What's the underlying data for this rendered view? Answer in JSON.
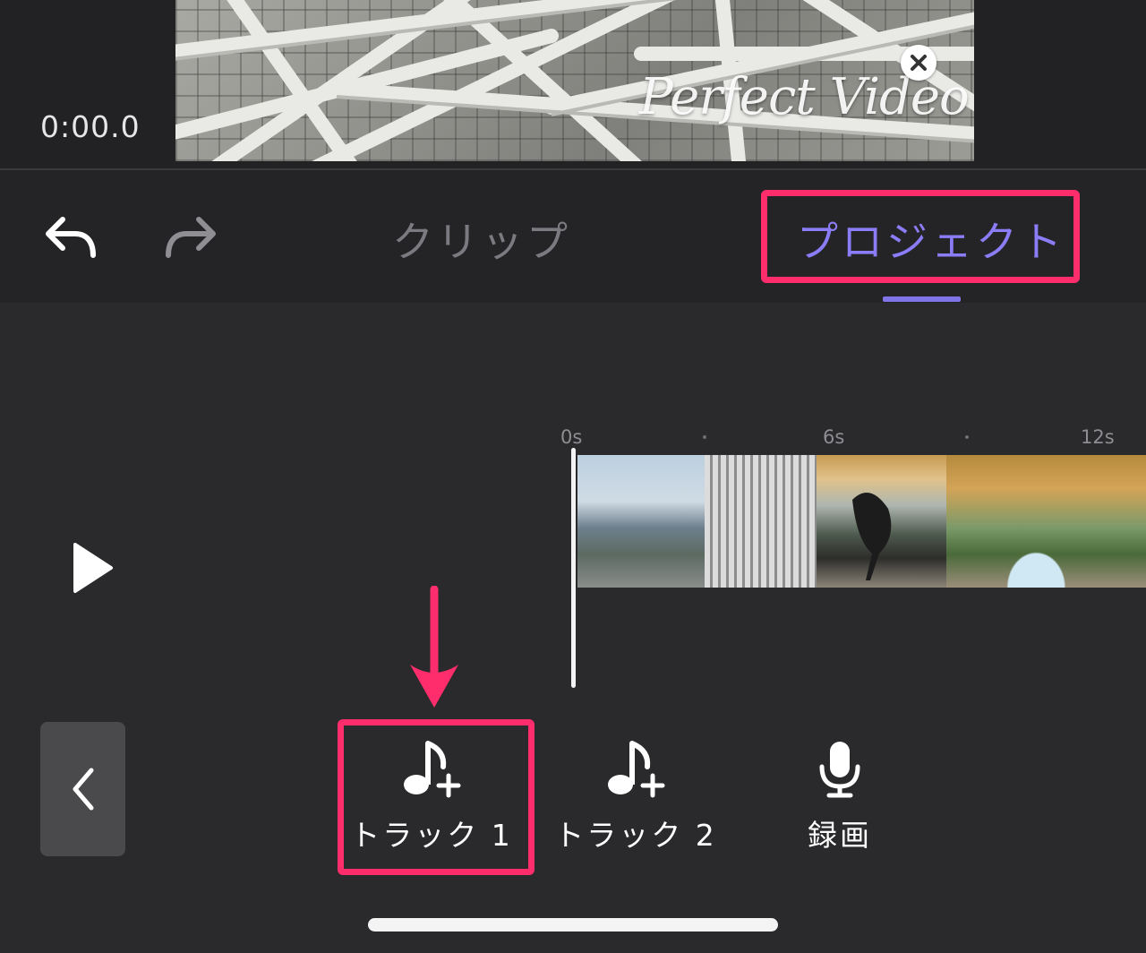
{
  "preview": {
    "timecode": "0:00.0",
    "watermark": "Perfect Video"
  },
  "toolbar": {
    "undo_icon": "undo-arrow",
    "redo_icon": "redo-arrow",
    "tabs": [
      {
        "label": "クリップ",
        "active": false
      },
      {
        "label": "プロジェクト",
        "active": true
      }
    ]
  },
  "timeline": {
    "ruler": [
      "0s",
      "6s",
      "12s"
    ],
    "playhead_time": "0:00.0",
    "clips": [
      {
        "icon": "harbor-skyline-thumbnail"
      },
      {
        "icon": "tower-building-thumbnail"
      },
      {
        "icon": "sculpture-atrium-thumbnail"
      },
      {
        "icon": "arched-walkway-thumbnail"
      }
    ]
  },
  "controls": {
    "play_icon": "play-triangle",
    "back_icon": "chevron-left"
  },
  "actions": [
    {
      "label": "トラック 1",
      "icon": "music-note-plus",
      "highlighted": true
    },
    {
      "label": "トラック 2",
      "icon": "music-note-plus",
      "highlighted": false
    },
    {
      "label": "録画",
      "icon": "microphone",
      "highlighted": false
    }
  ],
  "colors": {
    "accent": "#8b7cf7",
    "highlight": "#ff2d6b",
    "background": "#2a2a2c"
  }
}
